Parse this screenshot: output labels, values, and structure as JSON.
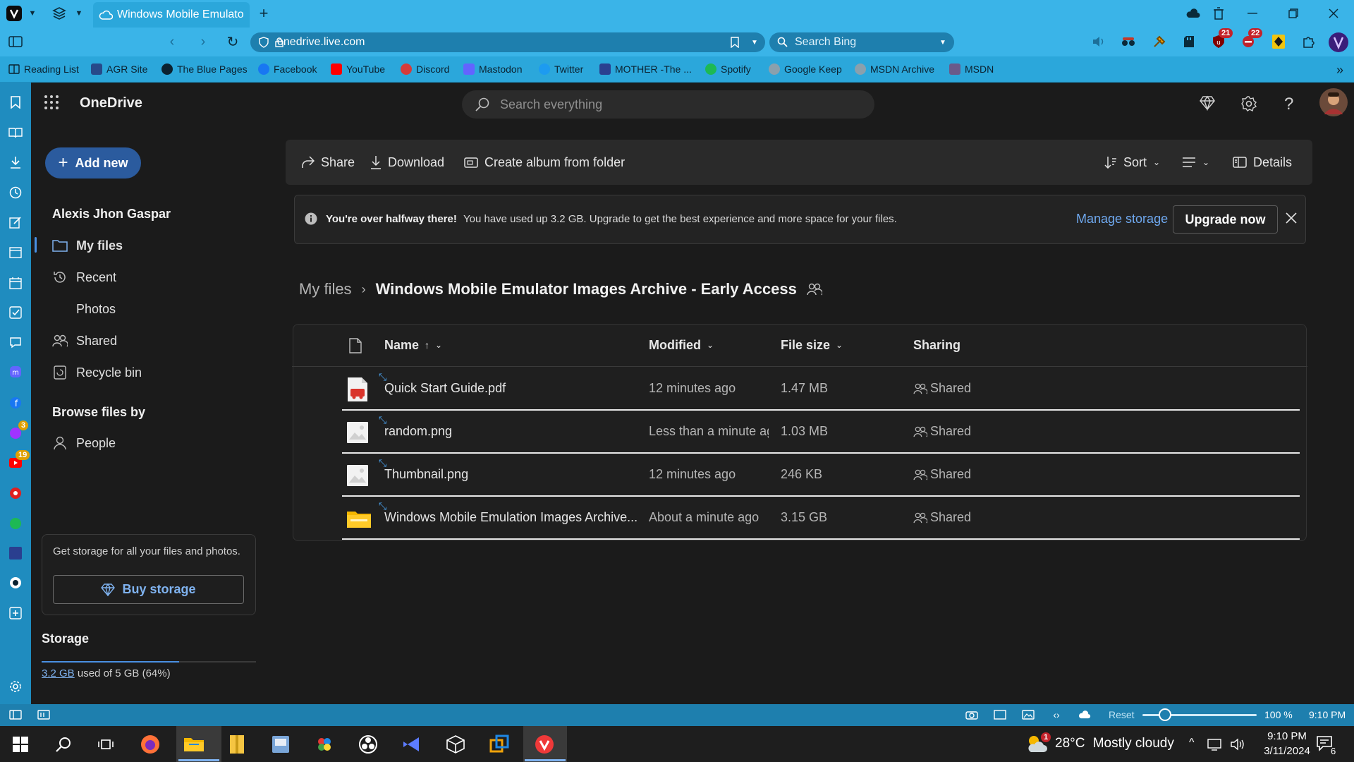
{
  "browser": {
    "tab_title": "Windows Mobile Emulator I",
    "url": "onedrive.live.com",
    "search_placeholder": "Search Bing",
    "badges": {
      "ublock": "21",
      "ext2": "22"
    },
    "bookmarks": [
      {
        "label": "Reading List"
      },
      {
        "label": "AGR Site"
      },
      {
        "label": "The Blue Pages"
      },
      {
        "label": "Facebook"
      },
      {
        "label": "YouTube"
      },
      {
        "label": "Discord"
      },
      {
        "label": "Mastodon"
      },
      {
        "label": "Twitter"
      },
      {
        "label": "MOTHER -The ..."
      },
      {
        "label": "Spotify"
      },
      {
        "label": "Google Keep"
      },
      {
        "label": "MSDN Archive"
      },
      {
        "label": "MSDN"
      }
    ],
    "panel_badges": {
      "messenger": "3",
      "youtube": "19"
    },
    "status": {
      "reset_label": "Reset",
      "zoom": "100 %",
      "time": "9:10 PM"
    }
  },
  "onedrive": {
    "app_title": "OneDrive",
    "search_placeholder": "Search everything",
    "add_new_label": "Add new",
    "user_name": "Alexis Jhon Gaspar",
    "nav": [
      {
        "label": "My files",
        "icon": "folder-icon"
      },
      {
        "label": "Recent",
        "icon": "history-icon"
      },
      {
        "label": "Photos",
        "icon": ""
      },
      {
        "label": "Shared",
        "icon": "people-icon"
      },
      {
        "label": "Recycle bin",
        "icon": "recycle-bin-icon"
      }
    ],
    "browse_heading": "Browse files by",
    "browse_people": "People",
    "storage_card_text": "Get storage for all your files and photos.",
    "buy_storage_label": "Buy storage",
    "storage_heading": "Storage",
    "storage_used_link": "3.2 GB",
    "storage_used_rest": " used of 5 GB (64%)",
    "storage_fraction": 0.64,
    "toolbar": {
      "share": "Share",
      "download": "Download",
      "create_album": "Create album from folder",
      "sort": "Sort",
      "details": "Details"
    },
    "banner": {
      "bold": "You're over halfway there!",
      "text": "You have used up 3.2 GB. Upgrade to get the best experience and more space for your files.",
      "manage": "Manage storage",
      "upgrade": "Upgrade now"
    },
    "breadcrumb": {
      "root": "My files",
      "current": "Windows Mobile Emulator Images Archive - Early Access"
    },
    "columns": {
      "name": "Name",
      "modified": "Modified",
      "size": "File size",
      "sharing": "Sharing"
    },
    "files": [
      {
        "name": "Quick Start Guide.pdf",
        "modified": "12 minutes ago",
        "size": "1.47 MB",
        "sharing": "Shared",
        "type": "pdf"
      },
      {
        "name": "random.png",
        "modified": "Less than a minute ag",
        "size": "1.03 MB",
        "sharing": "Shared",
        "type": "image"
      },
      {
        "name": "Thumbnail.png",
        "modified": "12 minutes ago",
        "size": "246 KB",
        "sharing": "Shared",
        "type": "image"
      },
      {
        "name": "Windows Mobile Emulation Images Archive...",
        "modified": "About a minute ago",
        "size": "3.15 GB",
        "sharing": "Shared",
        "type": "folder"
      }
    ]
  },
  "taskbar": {
    "weather_temp": "28°C",
    "weather_text": "Mostly cloudy",
    "weather_badge": "1",
    "clock_time": "9:10 PM",
    "clock_date": "3/11/2024",
    "notif_count": "6"
  }
}
